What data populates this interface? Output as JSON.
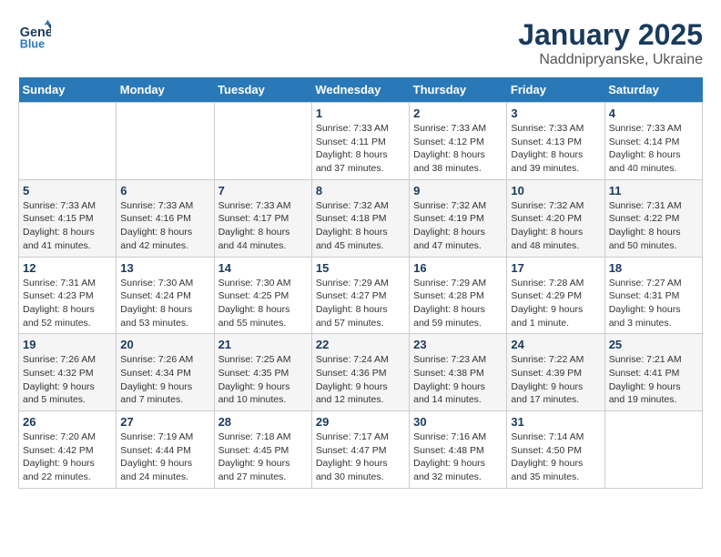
{
  "header": {
    "logo_line1": "General",
    "logo_line2": "Blue",
    "month": "January 2025",
    "location": "Naddnipryanske, Ukraine"
  },
  "weekdays": [
    "Sunday",
    "Monday",
    "Tuesday",
    "Wednesday",
    "Thursday",
    "Friday",
    "Saturday"
  ],
  "weeks": [
    [
      {
        "day": "",
        "info": ""
      },
      {
        "day": "",
        "info": ""
      },
      {
        "day": "",
        "info": ""
      },
      {
        "day": "1",
        "info": "Sunrise: 7:33 AM\nSunset: 4:11 PM\nDaylight: 8 hours and 37 minutes."
      },
      {
        "day": "2",
        "info": "Sunrise: 7:33 AM\nSunset: 4:12 PM\nDaylight: 8 hours and 38 minutes."
      },
      {
        "day": "3",
        "info": "Sunrise: 7:33 AM\nSunset: 4:13 PM\nDaylight: 8 hours and 39 minutes."
      },
      {
        "day": "4",
        "info": "Sunrise: 7:33 AM\nSunset: 4:14 PM\nDaylight: 8 hours and 40 minutes."
      }
    ],
    [
      {
        "day": "5",
        "info": "Sunrise: 7:33 AM\nSunset: 4:15 PM\nDaylight: 8 hours and 41 minutes."
      },
      {
        "day": "6",
        "info": "Sunrise: 7:33 AM\nSunset: 4:16 PM\nDaylight: 8 hours and 42 minutes."
      },
      {
        "day": "7",
        "info": "Sunrise: 7:33 AM\nSunset: 4:17 PM\nDaylight: 8 hours and 44 minutes."
      },
      {
        "day": "8",
        "info": "Sunrise: 7:32 AM\nSunset: 4:18 PM\nDaylight: 8 hours and 45 minutes."
      },
      {
        "day": "9",
        "info": "Sunrise: 7:32 AM\nSunset: 4:19 PM\nDaylight: 8 hours and 47 minutes."
      },
      {
        "day": "10",
        "info": "Sunrise: 7:32 AM\nSunset: 4:20 PM\nDaylight: 8 hours and 48 minutes."
      },
      {
        "day": "11",
        "info": "Sunrise: 7:31 AM\nSunset: 4:22 PM\nDaylight: 8 hours and 50 minutes."
      }
    ],
    [
      {
        "day": "12",
        "info": "Sunrise: 7:31 AM\nSunset: 4:23 PM\nDaylight: 8 hours and 52 minutes."
      },
      {
        "day": "13",
        "info": "Sunrise: 7:30 AM\nSunset: 4:24 PM\nDaylight: 8 hours and 53 minutes."
      },
      {
        "day": "14",
        "info": "Sunrise: 7:30 AM\nSunset: 4:25 PM\nDaylight: 8 hours and 55 minutes."
      },
      {
        "day": "15",
        "info": "Sunrise: 7:29 AM\nSunset: 4:27 PM\nDaylight: 8 hours and 57 minutes."
      },
      {
        "day": "16",
        "info": "Sunrise: 7:29 AM\nSunset: 4:28 PM\nDaylight: 8 hours and 59 minutes."
      },
      {
        "day": "17",
        "info": "Sunrise: 7:28 AM\nSunset: 4:29 PM\nDaylight: 9 hours and 1 minute."
      },
      {
        "day": "18",
        "info": "Sunrise: 7:27 AM\nSunset: 4:31 PM\nDaylight: 9 hours and 3 minutes."
      }
    ],
    [
      {
        "day": "19",
        "info": "Sunrise: 7:26 AM\nSunset: 4:32 PM\nDaylight: 9 hours and 5 minutes."
      },
      {
        "day": "20",
        "info": "Sunrise: 7:26 AM\nSunset: 4:34 PM\nDaylight: 9 hours and 7 minutes."
      },
      {
        "day": "21",
        "info": "Sunrise: 7:25 AM\nSunset: 4:35 PM\nDaylight: 9 hours and 10 minutes."
      },
      {
        "day": "22",
        "info": "Sunrise: 7:24 AM\nSunset: 4:36 PM\nDaylight: 9 hours and 12 minutes."
      },
      {
        "day": "23",
        "info": "Sunrise: 7:23 AM\nSunset: 4:38 PM\nDaylight: 9 hours and 14 minutes."
      },
      {
        "day": "24",
        "info": "Sunrise: 7:22 AM\nSunset: 4:39 PM\nDaylight: 9 hours and 17 minutes."
      },
      {
        "day": "25",
        "info": "Sunrise: 7:21 AM\nSunset: 4:41 PM\nDaylight: 9 hours and 19 minutes."
      }
    ],
    [
      {
        "day": "26",
        "info": "Sunrise: 7:20 AM\nSunset: 4:42 PM\nDaylight: 9 hours and 22 minutes."
      },
      {
        "day": "27",
        "info": "Sunrise: 7:19 AM\nSunset: 4:44 PM\nDaylight: 9 hours and 24 minutes."
      },
      {
        "day": "28",
        "info": "Sunrise: 7:18 AM\nSunset: 4:45 PM\nDaylight: 9 hours and 27 minutes."
      },
      {
        "day": "29",
        "info": "Sunrise: 7:17 AM\nSunset: 4:47 PM\nDaylight: 9 hours and 30 minutes."
      },
      {
        "day": "30",
        "info": "Sunrise: 7:16 AM\nSunset: 4:48 PM\nDaylight: 9 hours and 32 minutes."
      },
      {
        "day": "31",
        "info": "Sunrise: 7:14 AM\nSunset: 4:50 PM\nDaylight: 9 hours and 35 minutes."
      },
      {
        "day": "",
        "info": ""
      }
    ]
  ]
}
